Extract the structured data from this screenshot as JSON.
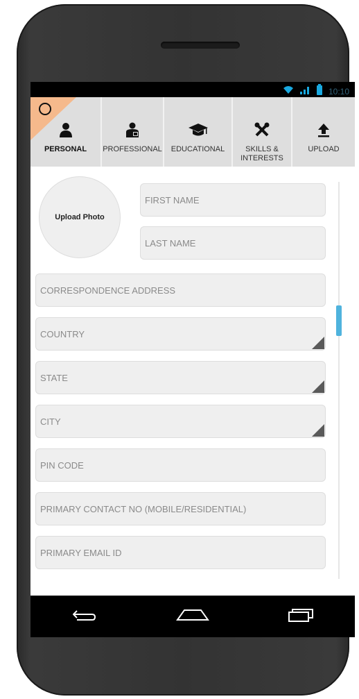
{
  "status": {
    "time": "10:10"
  },
  "tabs": [
    {
      "id": "personal",
      "label": "PERSONAL",
      "icon": "person-icon",
      "active": true
    },
    {
      "id": "professional",
      "label": "PROFESSIONAL",
      "icon": "businessman-icon",
      "active": false
    },
    {
      "id": "educational",
      "label": "EDUCATIONAL",
      "icon": "graduation-cap-icon",
      "active": false
    },
    {
      "id": "skills",
      "label_line1": "SKILLS &",
      "label_line2": "INTERESTS",
      "icon": "tools-icon",
      "active": false
    },
    {
      "id": "upload",
      "label": "UPLOAD",
      "icon": "upload-icon",
      "active": false
    }
  ],
  "form": {
    "upload_photo": "Upload Photo",
    "first_name": "FIRST NAME",
    "last_name": "LAST NAME",
    "address": "CORRESPONDENCE ADDRESS",
    "country": "COUNTRY",
    "state": "STATE",
    "city": "CITY",
    "pin": "PIN CODE",
    "contact": "PRIMARY CONTACT NO (MOBILE/RESIDENTIAL)",
    "email": "PRIMARY EMAIL ID"
  },
  "colors": {
    "accent": "#f5b98c",
    "scrollbar": "#4fb3dd",
    "status_icons": "#19a9e0"
  }
}
